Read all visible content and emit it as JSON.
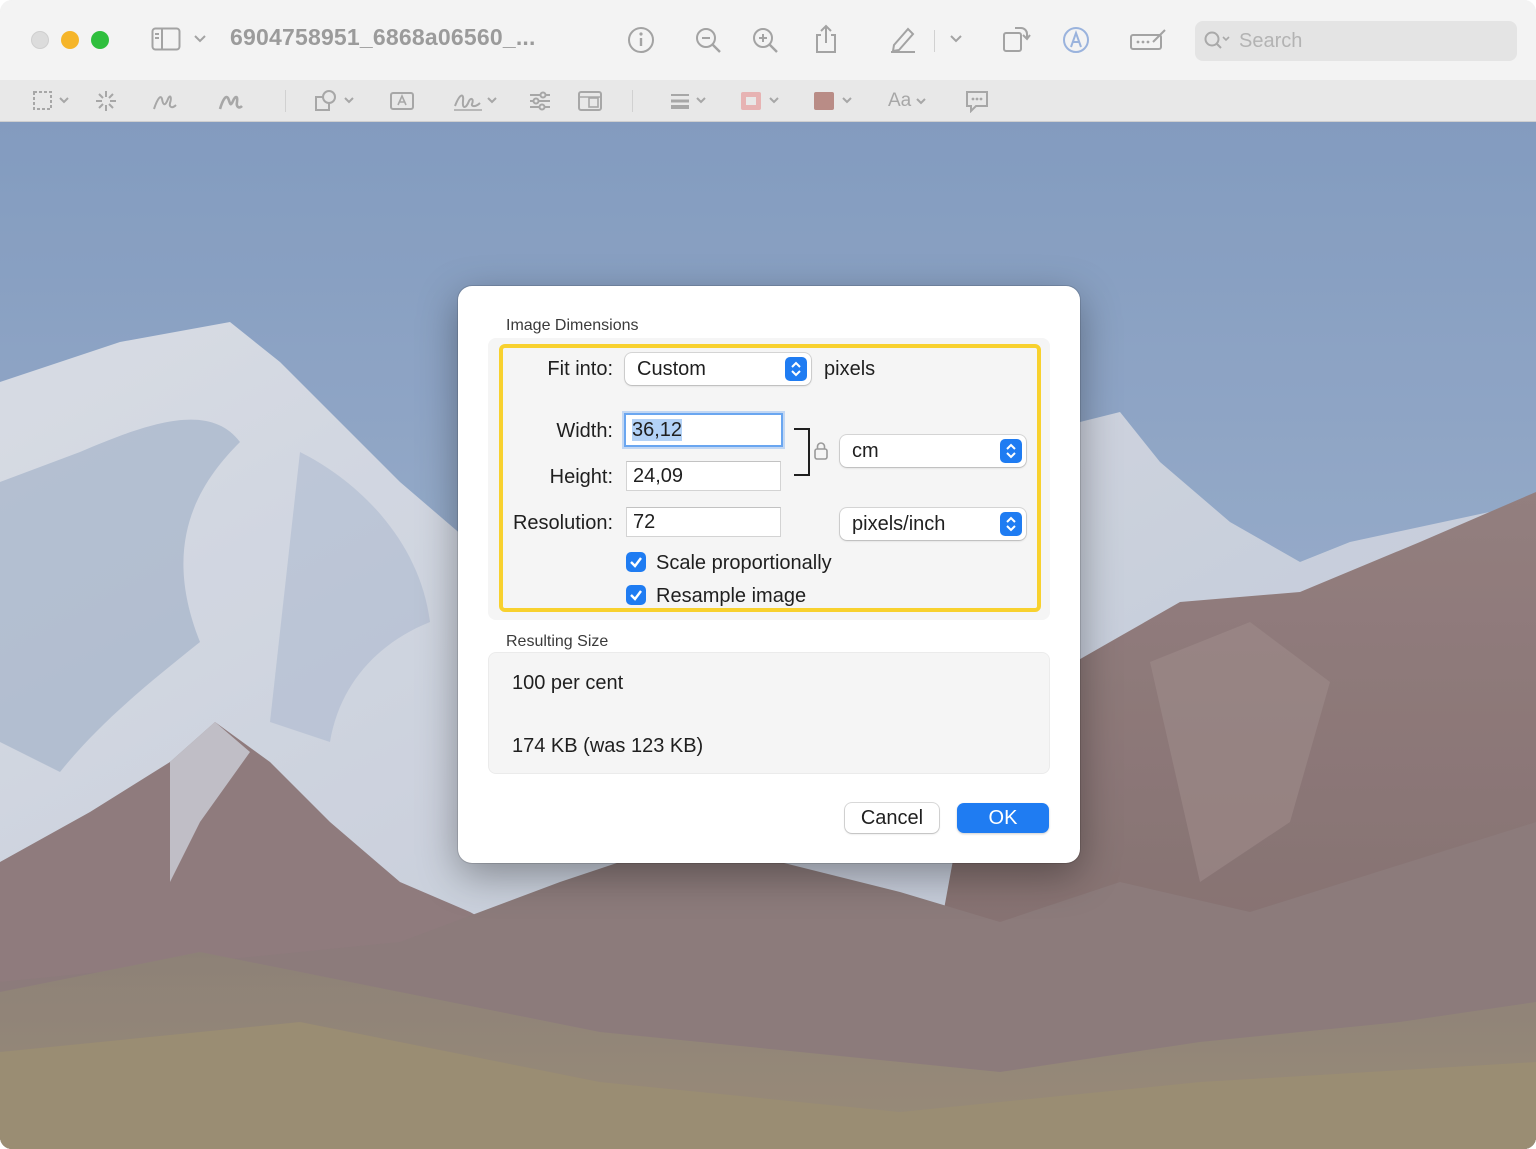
{
  "window": {
    "title": "6904758951_6868a06560_...",
    "search_placeholder": "Search"
  },
  "markup_toolbar": {
    "text_style_label": "Aa"
  },
  "dialog": {
    "image_dimensions_label": "Image Dimensions",
    "fit_into": {
      "label": "Fit into:",
      "value": "Custom",
      "unit": "pixels"
    },
    "width": {
      "label": "Width:",
      "value": "36,12"
    },
    "height": {
      "label": "Height:",
      "value": "24,09"
    },
    "size_unit": "cm",
    "resolution": {
      "label": "Resolution:",
      "value": "72",
      "unit": "pixels/inch"
    },
    "scale_proportionally": {
      "label": "Scale proportionally",
      "checked": true
    },
    "resample_image": {
      "label": "Resample image",
      "checked": true
    },
    "resulting_size_label": "Resulting Size",
    "resulting_percent": "100 per cent",
    "resulting_filesize": "174 KB (was 123 KB)",
    "cancel_label": "Cancel",
    "ok_label": "OK"
  },
  "colors": {
    "accent": "#1f7cf2",
    "highlight": "#f8d12e"
  }
}
